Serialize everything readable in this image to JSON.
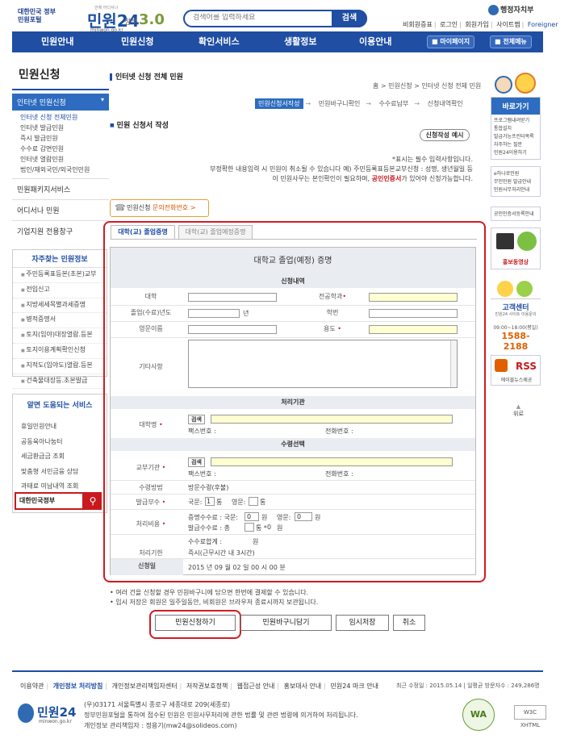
{
  "header": {
    "logo_badge": "대한민국 정부민원포털",
    "logo_title": "민원24",
    "logo_sub": "minwon.go.kr",
    "logo_note": "언제 어디서나",
    "gov_label": "정부",
    "gov_version": "3.0",
    "search_placeholder": "검색어를 입력하세요",
    "search_button": "검색",
    "ministry": "행정자치부",
    "top_links": [
      "비회원증표",
      "로그인",
      "회원가입",
      "사이트맵"
    ],
    "foreigner": "Foreigner"
  },
  "nav": {
    "items": [
      "민원안내",
      "민원신청",
      "확인서비스",
      "생활정보",
      "이용안내"
    ],
    "mypage": "마이페이지",
    "all_menu": "전체메뉴"
  },
  "left": {
    "title": "민원신청",
    "active": "인터넷 민원신청",
    "sub_items": [
      "인터넷 신청 전체민원",
      "인터넷 발급민원",
      "즉시 발급민원",
      "수수료 감면민원",
      "인터넷 열람민원",
      "법인/재외국민/외국인민원"
    ],
    "main_items": [
      "민원패키지서비스",
      "어디서나 민원",
      "기업지원 전용창구"
    ],
    "faq_title": "자주찾는 민원정보",
    "faq_items": [
      "주민등록표등본(초본)교부",
      "전입신고",
      "지방세세목별과세증명",
      "병적증명서",
      "토지(임야)대장열람.등본",
      "토지이용계획확인신청",
      "지적도(임야도)열람.등본",
      "건축물대장등.초본발급"
    ],
    "help_title": "알면 도움되는 서비스",
    "help_items": [
      "휴일민원안내",
      "공동육아나눔터",
      "세금환급금 조회",
      "맞춤형 서민금융 상담",
      "과태료 미납내역 조회"
    ],
    "gov_box": "대한민국정부"
  },
  "right": {
    "quick_title": "바로가기",
    "quick_items": [
      "프로그램내려받기",
      "통합설치",
      "발급가능프린터목록",
      "자주하는 질문",
      "민원24이용하기"
    ],
    "items2": [
      "e하나로민원",
      "무인민원 발급안내",
      "민원사무처리안내"
    ],
    "item3": "공인인증서등록안내",
    "promo": "홍보동영상",
    "center_title": "고객센터",
    "center_sub": "민원24 사이트 이용문의",
    "center_hours": "09:00~18:00(평일)",
    "center_phone": "1588-2188",
    "rss_label": "RSS",
    "rss_sub": "에이블뉴스제공",
    "top": "위로"
  },
  "main": {
    "page_title": "인터넷 신청 전체 민원",
    "breadcrumb": "홈 > 민원신청 > 인터넷 신청 전체 민원",
    "steps": [
      "민원신청서작성",
      "민원바구니확인",
      "수수료납부",
      "신청내역확인"
    ],
    "form_heading": "민원 신청서 작성",
    "example_button": "신청작성 예시",
    "notice_1": "*표시는 필수 입력사항입니다.",
    "notice_2": "부정확한 내용입력 시 민원이 취소될 수 있습니다  예) 주민등록표등본교부신청 : 성명, 생년월일 등",
    "notice_3a": "이 민원사무는 본인확인이 필요하며,",
    "notice_3b": "공인인증서",
    "notice_3c": "가 있어야 신청가능합니다.",
    "inquiry_a": "민원신청",
    "inquiry_b": "문의전화번호",
    "inquiry_c": ">"
  },
  "form": {
    "tabs": [
      "대학(교) 졸업증명",
      "대학(교) 졸업예정증명"
    ],
    "title": "대학교 졸업(예정) 증명",
    "sec1": "신청내역",
    "university": "대학",
    "major": "전공학과",
    "grad_year": "졸업(수료)년도",
    "year_unit": "년",
    "student_id": "학번",
    "eng_name": "영문이름",
    "purpose": "용도",
    "etc": "기타사항",
    "sec2": "처리기관",
    "univ_name": "대학명",
    "search": "검색",
    "fax": "팩스번호 :",
    "phone": "전화번호 :",
    "sec3": "수령선택",
    "issuer": "교부기관",
    "receive_method": "수령방법",
    "receive_value": "방문수령(후불)",
    "copies": "발급부수",
    "copies_kor": "국문:",
    "copies_kor_val": "1",
    "copies_unit": "통",
    "copies_eng": "영문:",
    "fee_label": "처리비용",
    "fee_cert": "증명수수료 : 국문:",
    "fee_cert_kor": "0",
    "fee_won": "원",
    "fee_cert_eng_label": "영문:",
    "fee_cert_eng": "0",
    "fee_issue": "발급수수료 : 총",
    "fee_issue_copies": "통 *",
    "fee_issue_val": "0",
    "fee_total": "수수료합계 :",
    "fee_total_unit": "원",
    "period_label": "처리기한",
    "period_value": "즉시(근무시간 내 3시간)",
    "apply_date_label": "신청일",
    "apply_date": "2015  년 09 월 02 일 00  시  00 분"
  },
  "bottom": {
    "note_1": "• 여러 건을 신청할 경우 민원바구니에 담으면 한번에 결제할 수 있습니다.",
    "note_2": "• 임시 저장은 회원은 일주일동안, 비회원은 브라우저 종료시까지 보관됩니다.",
    "buttons": [
      "민원신청하기",
      "민원바구니담기",
      "임시저장",
      "취소"
    ]
  },
  "footer": {
    "links": [
      "이용약관",
      "개인정보 처리방침",
      "개인정보관리책임자센터",
      "저작권보호정책",
      "웹접근성 안내",
      "홍보대사 안내",
      "민원24 마크 안내"
    ],
    "revised": "최근 수정일 : 2015.05.14 | 일평균 방문자수 : 249,286명",
    "address": "(우)03171 서울특별시 종로구 세종대로 209(세종로)",
    "desc": "정부민원포털을 통하여 접수된 민원은 민원사무처리에 관한 법률 및 관련 법령에 의거하여 처리됩니다.",
    "privacy": "개인정보 관리책임자 : 정용기(mw24@solideos.com)",
    "wa": "WA",
    "w3c": "W3C XHTML"
  }
}
